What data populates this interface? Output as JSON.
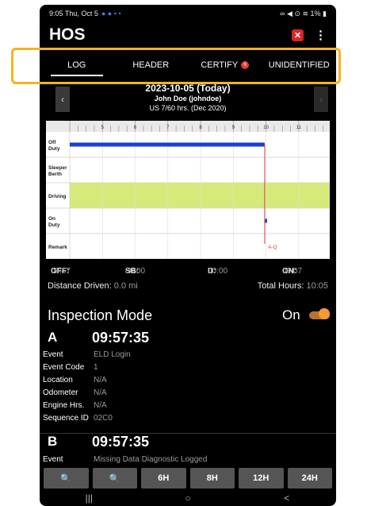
{
  "status_bar": {
    "time_date": "9:05 Thu, Oct 5",
    "right_indicators": "1%"
  },
  "app_bar": {
    "title": "HOS",
    "close_icon": "close-icon",
    "more_icon": "more-vert-icon"
  },
  "tabs": [
    {
      "label": "LOG",
      "active": true
    },
    {
      "label": "HEADER"
    },
    {
      "label": "CERTIFY",
      "badge": "6"
    },
    {
      "label": "UNIDENTIFIED"
    }
  ],
  "log_header": {
    "date": "2023-10-05 (Today)",
    "driver": "John Doe (johndoe)",
    "rule": "US 7/60 hrs. (Dec 2020)"
  },
  "chart_data": {
    "type": "line",
    "x_ticks": [
      "5",
      "6",
      "7",
      "8",
      "9",
      "10",
      "11"
    ],
    "rows": [
      "Off Duty",
      "Sleeper Berth",
      "Driving",
      "On Duty",
      "Remark"
    ],
    "segments": [
      {
        "status": "Off Duty",
        "start_hour": 4.0,
        "end_hour": 9.96
      },
      {
        "status": "On Duty",
        "start_hour": 9.96,
        "end_hour": 10.0
      }
    ],
    "remark_label": "A-Q",
    "remark_hour": 9.96,
    "current_hour": 9.96
  },
  "summary": {
    "off_label": "OFF:",
    "off_value": "09:57",
    "sb_label": "SB:",
    "sb_value": "00:00",
    "d_label": "D:",
    "d_value": "00:00",
    "on_label": "ON:",
    "on_value": "00:07"
  },
  "distance": {
    "label": "Distance Driven:",
    "value": "0.0 mi",
    "total_label": "Total Hours:",
    "total_value": "10:05"
  },
  "inspection": {
    "label": "Inspection Mode",
    "state": "On"
  },
  "events": [
    {
      "letter": "A",
      "time": "09:57:35",
      "fields": [
        {
          "label": "Event",
          "value": "ELD Login"
        },
        {
          "label": "Event Code",
          "value": "1"
        },
        {
          "label": "Location",
          "value": "N/A"
        },
        {
          "label": "Odometer",
          "value": "N/A"
        },
        {
          "label": "Engine Hrs.",
          "value": "N/A"
        },
        {
          "label": "Sequence ID",
          "value": "02C0"
        }
      ]
    },
    {
      "letter": "B",
      "time": "09:57:35",
      "fields": [
        {
          "label": "Event",
          "value": "Missing Data Diagnostic Logged"
        }
      ]
    }
  ],
  "toolbar": [
    "🔍",
    "🔍",
    "6H",
    "8H",
    "12H",
    "24H"
  ],
  "nav": [
    "|||",
    "○",
    "<"
  ]
}
